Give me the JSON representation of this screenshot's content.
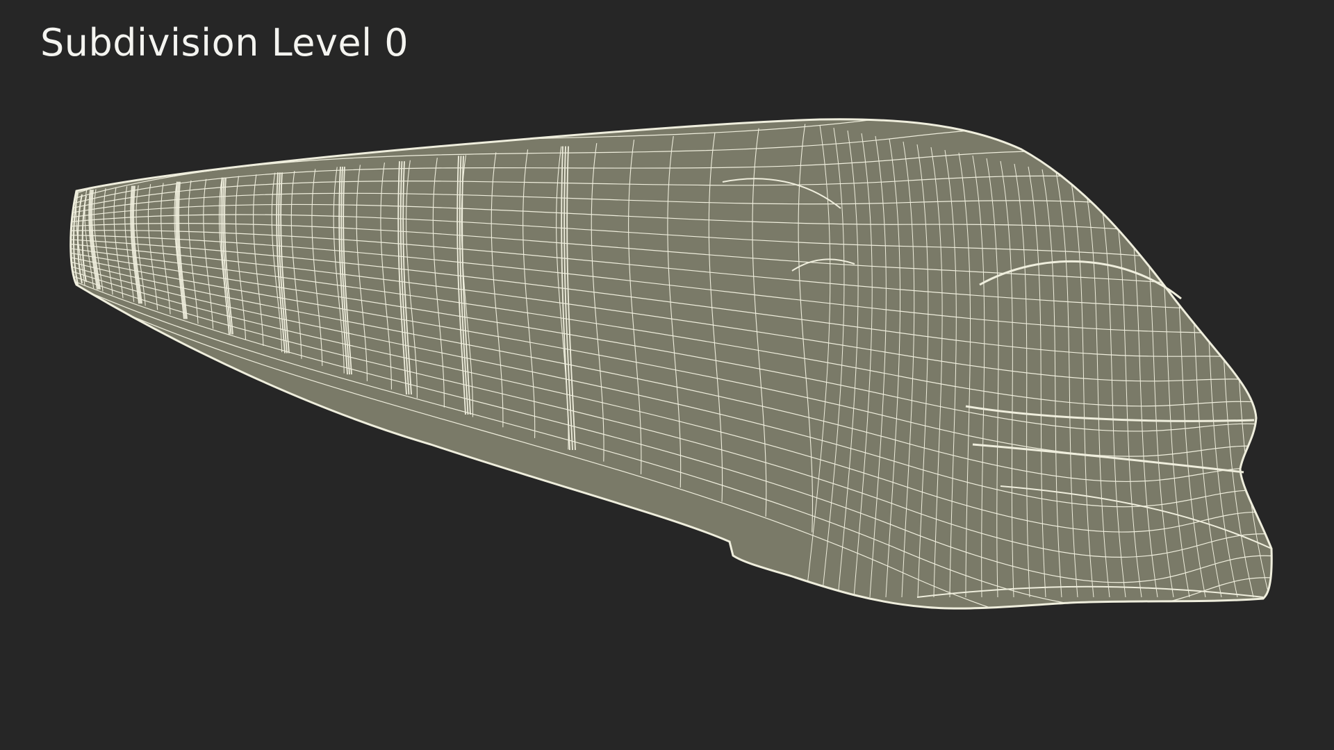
{
  "label": {
    "text": "Subdivision Level 0"
  },
  "render": {
    "subject": "train-wireframe",
    "colors": {
      "background": "#262626",
      "surface": "#7a7a68",
      "wire": "#efeedd",
      "label": "#f4f4f0"
    }
  }
}
